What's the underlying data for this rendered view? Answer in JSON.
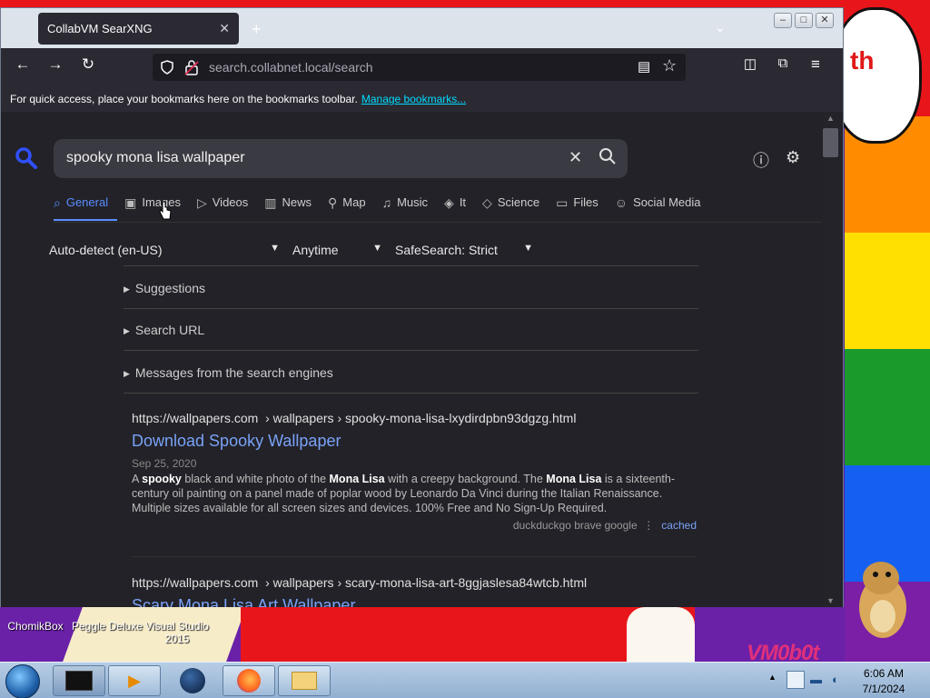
{
  "browser": {
    "tab_title": "CollabVM SearXNG",
    "url_host": "search.collabnet.local",
    "url_path": "/search",
    "bookmarks_message": "For quick access, place your bookmarks here on the bookmarks toolbar.",
    "bookmarks_link": "Manage bookmarks..."
  },
  "search": {
    "query": "spooky mona lisa wallpaper",
    "categories": [
      {
        "label": "General",
        "icon": "search-icon"
      },
      {
        "label": "Images",
        "icon": "image-icon"
      },
      {
        "label": "Videos",
        "icon": "play-icon"
      },
      {
        "label": "News",
        "icon": "newspaper-icon"
      },
      {
        "label": "Map",
        "icon": "map-pin-icon"
      },
      {
        "label": "Music",
        "icon": "music-icon"
      },
      {
        "label": "It",
        "icon": "layers-icon"
      },
      {
        "label": "Science",
        "icon": "graduation-icon"
      },
      {
        "label": "Files",
        "icon": "files-icon"
      },
      {
        "label": "Social Media",
        "icon": "people-icon"
      }
    ],
    "filters": {
      "language": "Auto-detect (en-US)",
      "time": "Anytime",
      "safesearch": "SafeSearch: Strict"
    },
    "sections": [
      "Suggestions",
      "Search URL",
      "Messages from the search engines"
    ]
  },
  "results": [
    {
      "url_host": "https://wallpapers.com",
      "url_path": "› wallpapers › spooky-mona-lisa-lxydirdpbn93dgzg.html",
      "title": "Download Spooky Wallpaper",
      "date": "Sep 25, 2020",
      "desc_1": "A ",
      "desc_b1": "spooky",
      "desc_2": " black and white photo of the ",
      "desc_b2": "Mona Lisa",
      "desc_3": " with a creepy background. The ",
      "desc_b3": "Mona Lisa",
      "desc_4": " is a sixteenth-century oil painting on a panel made of poplar wood by Leonardo Da Vinci during the Italian Renaissance. Multiple sizes available for all screen sizes and devices. 100% Free and No Sign-Up Required.",
      "engines": "duckduckgo   brave   google",
      "cached": "cached"
    },
    {
      "url_host": "https://wallpapers.com",
      "url_path": "› wallpapers › scary-mona-lisa-art-8ggjaslesa84wtcb.html",
      "title": "Scary Mona Lisa Art Wallpaper"
    }
  ],
  "desktop": {
    "icons": [
      "ChomikBox",
      "Peggle Deluxe",
      "Visual Studio 2015"
    ],
    "bubble_text": "th",
    "logo_text": "VM0b0t"
  },
  "taskbar": {
    "time": "6:06 AM",
    "date": "7/1/2024"
  },
  "colors": {
    "accent": "#5a8eff",
    "link": "#7aa2f7",
    "bookmark_link": "#00ddff"
  }
}
